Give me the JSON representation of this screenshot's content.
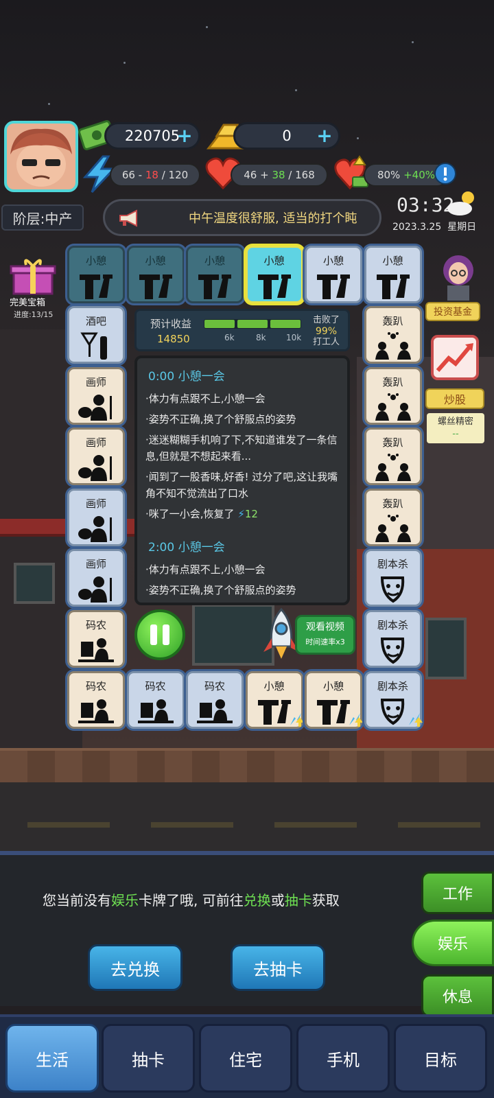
{
  "hud": {
    "money": "220705",
    "gold": "0",
    "energy": {
      "current": "66",
      "delta": "18",
      "max": "120"
    },
    "health": {
      "current": "46",
      "delta": "38",
      "max": "168"
    },
    "mood": {
      "value": "80%",
      "bonus": "+40%"
    },
    "level": "阶层:中产",
    "notice": "中午温度很舒服, 适当的打个盹",
    "time": "03:32",
    "date": "2023.3.25",
    "weekday": "星期日"
  },
  "chest": {
    "label": "完美宝箱",
    "progress": "进度:13/15"
  },
  "income": {
    "title": "预计收益",
    "value": "14850",
    "progress_fraction": 1.0,
    "ticks": [
      "6k",
      "8k",
      "10k"
    ],
    "beat_label": "击败了",
    "beat_percent": "99%",
    "beat_who": "打工人"
  },
  "board": {
    "top": [
      {
        "label": "小憩",
        "style": "dark"
      },
      {
        "label": "小憩",
        "style": "dark"
      },
      {
        "label": "小憩",
        "style": "dark"
      },
      {
        "label": "小憩",
        "style": "active"
      },
      {
        "label": "小憩",
        "style": "light"
      },
      {
        "label": "小憩",
        "style": "light"
      }
    ],
    "left": [
      {
        "label": "酒吧",
        "style": "light"
      },
      {
        "label": "画师",
        "style": "beige"
      },
      {
        "label": "画师",
        "style": "beige"
      },
      {
        "label": "画师",
        "style": "light"
      },
      {
        "label": "画师",
        "style": "light"
      },
      {
        "label": "码农",
        "style": "beige"
      }
    ],
    "right": [
      {
        "label": "轰趴",
        "style": "beige"
      },
      {
        "label": "轰趴",
        "style": "beige"
      },
      {
        "label": "轰趴",
        "style": "beige"
      },
      {
        "label": "轰趴",
        "style": "beige"
      },
      {
        "label": "剧本杀",
        "style": "light"
      },
      {
        "label": "剧本杀",
        "style": "light"
      }
    ],
    "bottom": [
      {
        "label": "码农",
        "style": "beige"
      },
      {
        "label": "码农",
        "style": "light"
      },
      {
        "label": "码农",
        "style": "light"
      },
      {
        "label": "小憩",
        "style": "beige"
      },
      {
        "label": "小憩",
        "style": "beige"
      },
      {
        "label": "剧本杀",
        "style": "light"
      }
    ]
  },
  "log": {
    "entries": [
      {
        "head": "0:00  小憩一会",
        "lines": [
          "·体力有点跟不上,小憩一会",
          "·姿势不正确,换了个舒服点的姿势",
          "·迷迷糊糊手机响了下,不知道谁发了一条信息,但就是不想起来看...",
          "·闻到了一股香味,好香! 过分了吧,这让我嘴角不知不觉流出了口水",
          "·咪了一小会,恢复了"
        ],
        "recover": "12"
      },
      {
        "head": "2:00  小憩一会",
        "lines": [
          "·体力有点跟不上,小憩一会",
          "·姿势不正确,换了个舒服点的姿势"
        ]
      }
    ]
  },
  "rocket": {
    "title": "观看视频",
    "sub": "时间速率x3"
  },
  "side_widgets": {
    "fund": "投资基金",
    "stock": "炒股",
    "screw_title": "螺丝精密",
    "screw_value": "--"
  },
  "panel": {
    "msg_pre": "您当前没有",
    "msg_hl1": "娱乐",
    "msg_mid": "卡牌了哦, 可前往",
    "msg_hl2": "兑换",
    "msg_or": "或",
    "msg_hl3": "抽卡",
    "msg_post": "获取",
    "btn_exchange": "去兑换",
    "btn_draw": "去抽卡"
  },
  "modes": [
    "工作",
    "娱乐",
    "休息"
  ],
  "tabs": [
    "生活",
    "抽卡",
    "住宅",
    "手机",
    "目标"
  ],
  "colors": {
    "accent_green": "#6ee052",
    "gold_text": "#f2d35b",
    "log_head": "#5ac8e6"
  }
}
